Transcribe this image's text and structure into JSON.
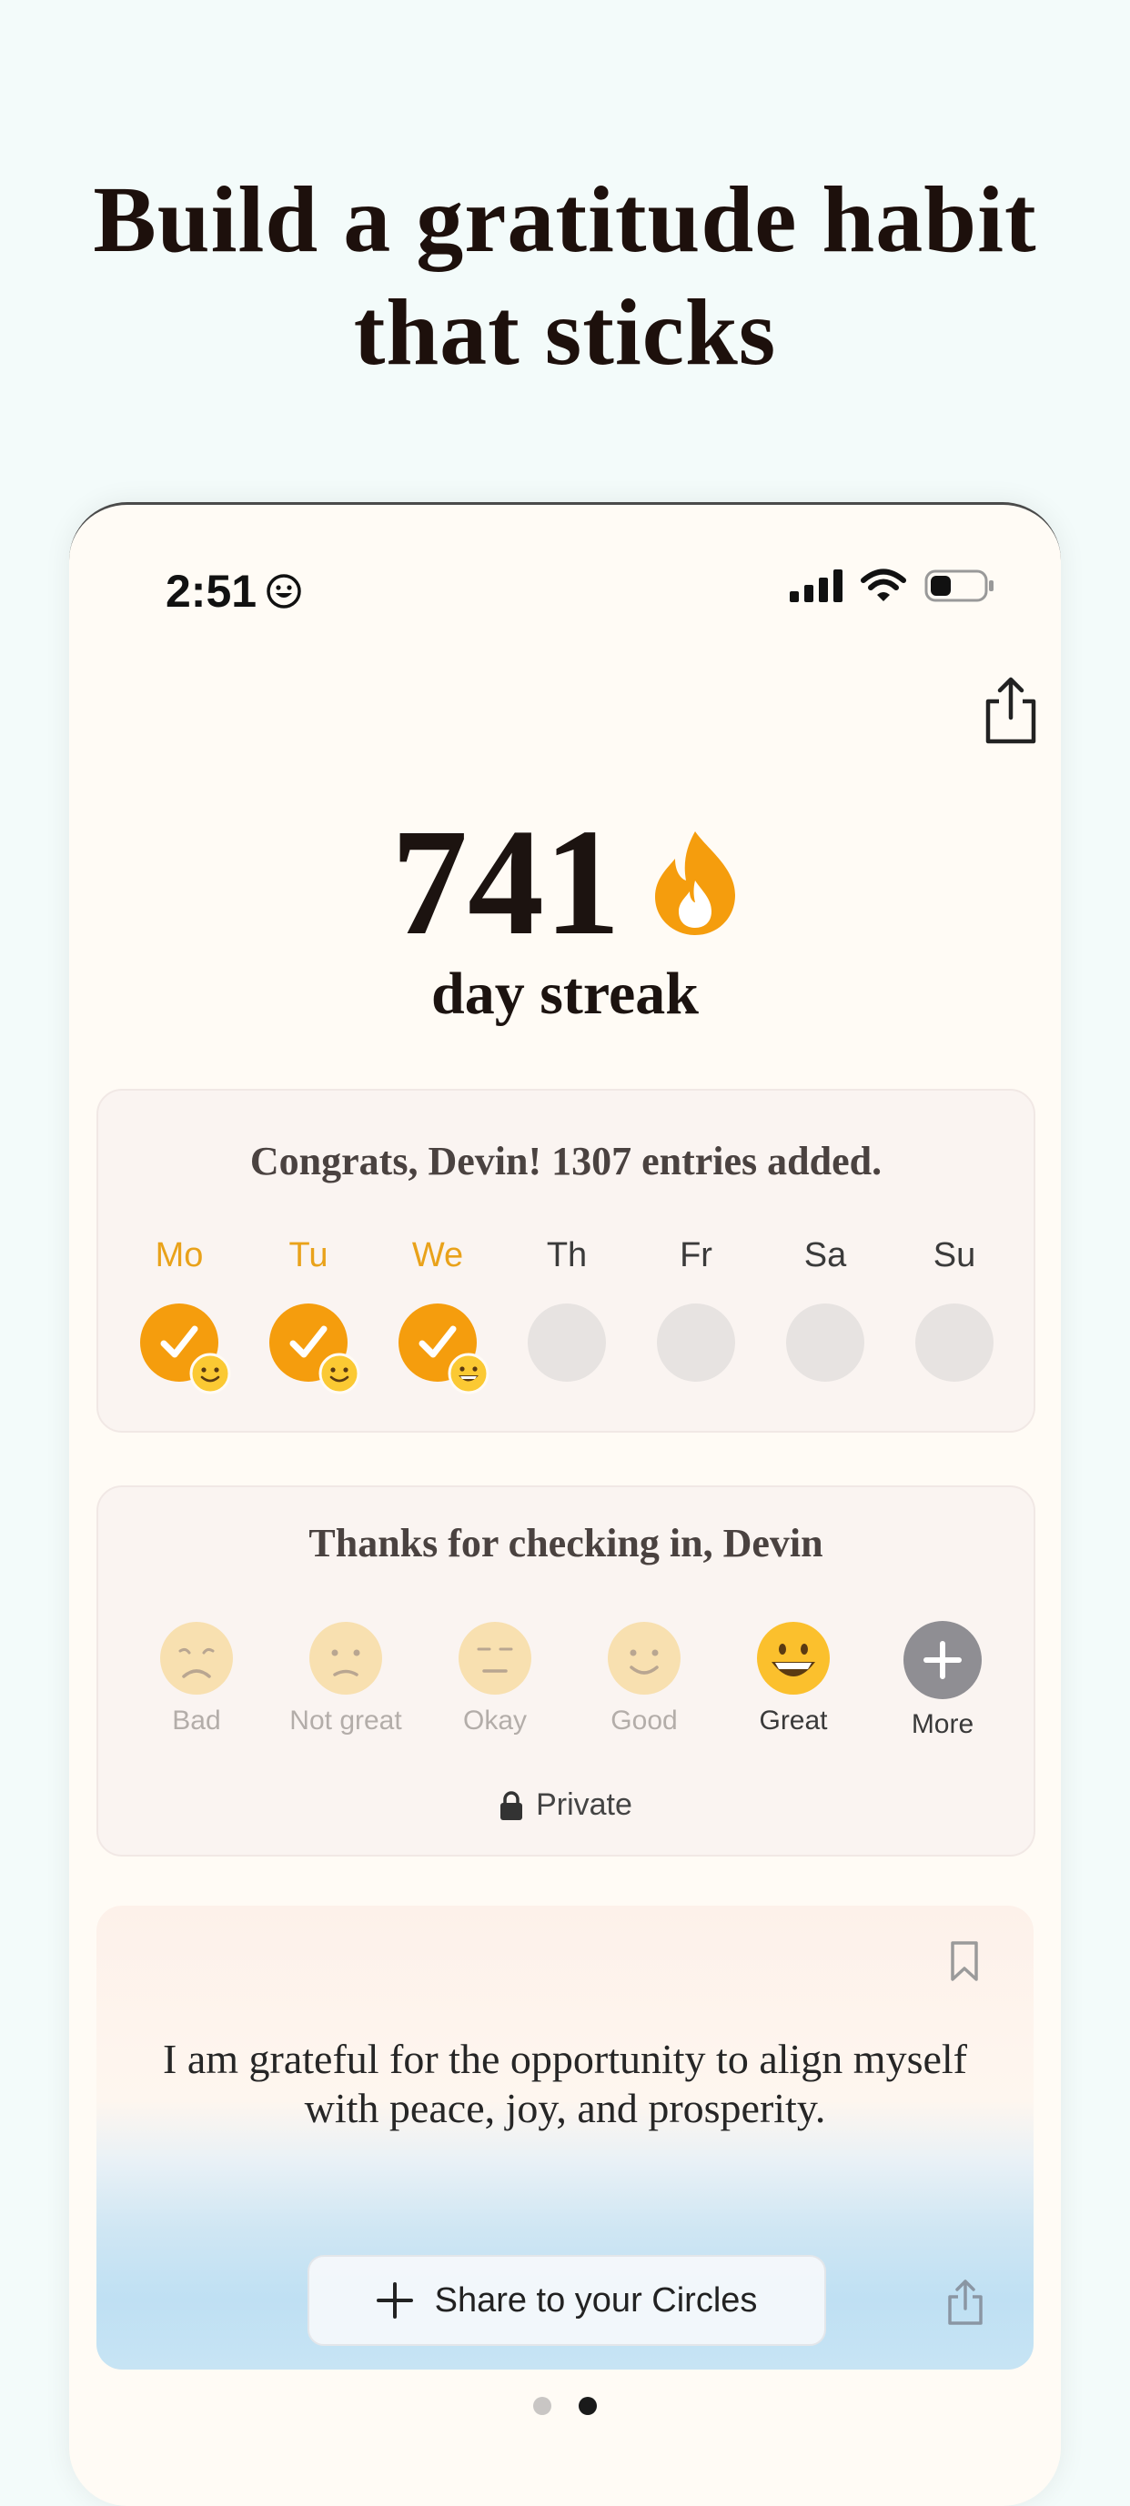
{
  "headline": {
    "line1": "Build a gratitude habit",
    "line2": "that sticks"
  },
  "status_bar": {
    "time": "2:51"
  },
  "streak": {
    "count": "741",
    "label": "day streak"
  },
  "week_card": {
    "title": "Congrats, Devin! 1307 entries added.",
    "days": [
      {
        "label": "Mo",
        "done": true
      },
      {
        "label": "Tu",
        "done": true
      },
      {
        "label": "We",
        "done": true
      },
      {
        "label": "Th",
        "done": false
      },
      {
        "label": "Fr",
        "done": false
      },
      {
        "label": "Sa",
        "done": false
      },
      {
        "label": "Su",
        "done": false
      }
    ]
  },
  "checkin_card": {
    "title": "Thanks for checking in, Devin",
    "moods": [
      "Bad",
      "Not great",
      "Okay",
      "Good",
      "Great",
      "More"
    ],
    "selected": "Great",
    "privacy": "Private"
  },
  "quote_card": {
    "text": "I am grateful for the opportunity to align myself with peace, joy, and prosperity.",
    "share_button": "Share to your Circles"
  },
  "pager": {
    "pages": 2,
    "active": 2
  },
  "colors": {
    "accent": "#f59d0d",
    "background": "#f3fbfa",
    "card": "#faf4f1"
  }
}
